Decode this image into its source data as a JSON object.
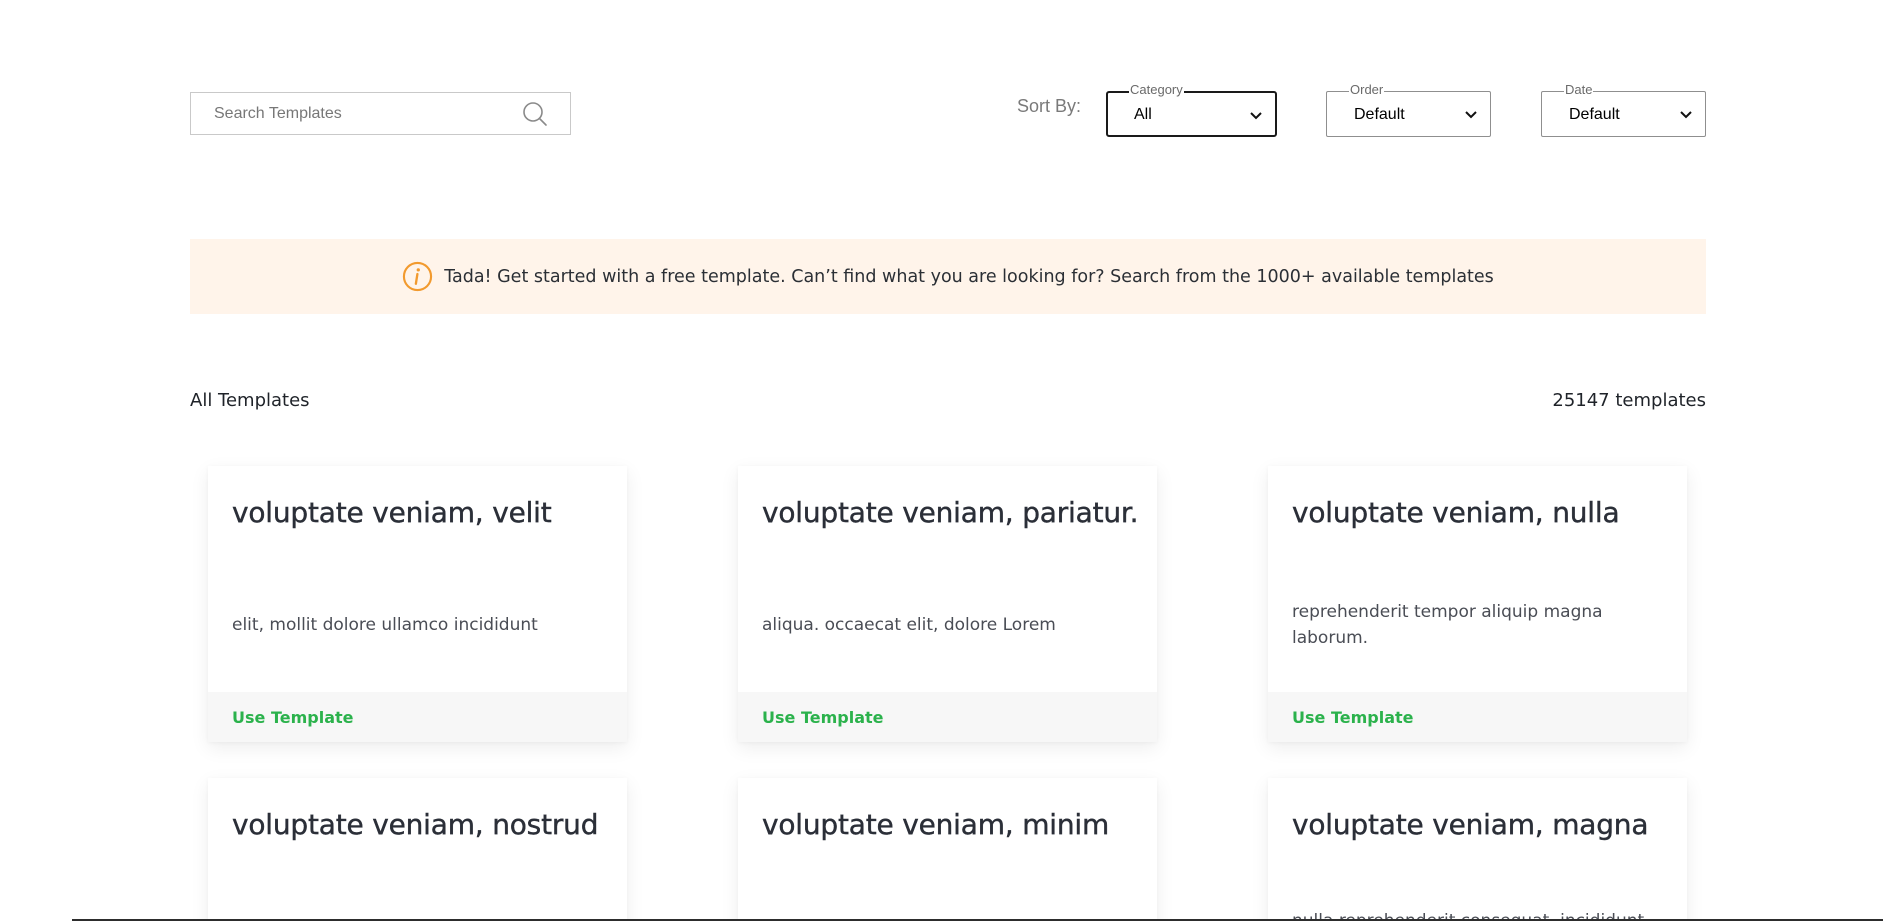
{
  "search": {
    "placeholder": "Search Templates",
    "value": "",
    "icon": "search-icon"
  },
  "sort": {
    "label": "Sort By:",
    "category": {
      "legend": "Category",
      "value": "All"
    },
    "order": {
      "legend": "Order",
      "value": "Default"
    },
    "date": {
      "legend": "Date",
      "value": "Default"
    }
  },
  "banner": {
    "icon": "info-icon",
    "icon_color": "#f29a2e",
    "background": "#fff4ea",
    "text": "Tada! Get started with a free template. Can’t find what you are looking for? Search from the 1000+ available templates"
  },
  "list": {
    "title": "All Templates",
    "count_text": "25147 templates"
  },
  "accent_color": "#2bb24c",
  "cards": [
    {
      "title": "voluptate veniam, velit",
      "description": "elit, mollit dolore ullamco incididunt",
      "action": "Use Template"
    },
    {
      "title": "voluptate veniam, pariatur.",
      "description": "aliqua. occaecat elit, dolore Lorem",
      "action": "Use Template"
    },
    {
      "title": "voluptate veniam, nulla",
      "description": "reprehenderit tempor aliquip magna laborum.",
      "action": "Use Template"
    },
    {
      "title": "voluptate veniam, nostrud",
      "description": "",
      "action": ""
    },
    {
      "title": "voluptate veniam, minim",
      "description": "",
      "action": ""
    },
    {
      "title": "voluptate veniam, magna",
      "description": "nulla reprehenderit consequat. incididunt",
      "action": ""
    }
  ]
}
